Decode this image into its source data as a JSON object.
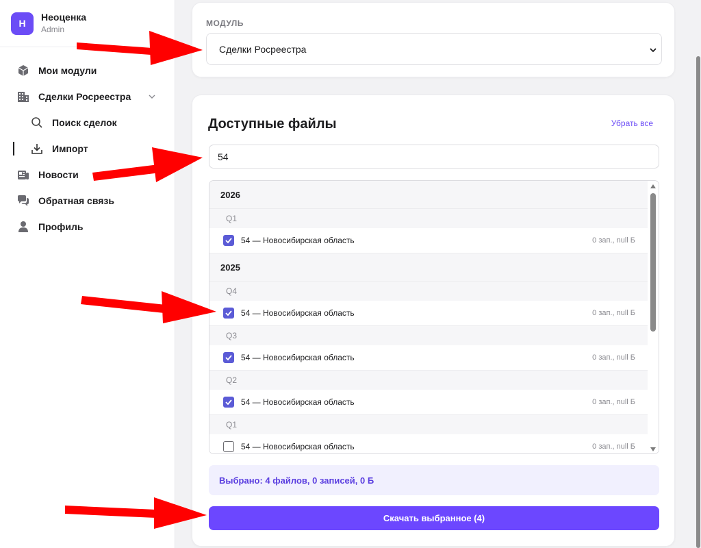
{
  "brand": {
    "initial": "Н",
    "name": "Неоценка",
    "role": "Admin"
  },
  "sidebar": {
    "items": [
      {
        "label": "Мои модули",
        "icon": "cube-icon"
      },
      {
        "label": "Сделки Росреестра",
        "icon": "building-icon"
      },
      {
        "label": "Поиск сделок",
        "icon": "search-icon"
      },
      {
        "label": "Импорт",
        "icon": "download-icon"
      },
      {
        "label": "Новости",
        "icon": "newspaper-icon"
      },
      {
        "label": "Обратная связь",
        "icon": "chat-icon"
      },
      {
        "label": "Профиль",
        "icon": "user-icon"
      }
    ]
  },
  "module": {
    "label": "МОДУЛЬ",
    "selected": "Сделки Росреестра"
  },
  "files": {
    "title": "Доступные файлы",
    "clear_all": "Убрать все",
    "search_value": "54",
    "groups": [
      {
        "year": "2026",
        "quarter": "Q1",
        "file": {
          "name": "54 — Новосибирская область",
          "meta": "0 зап., null Б",
          "checked": true
        }
      },
      {
        "year": "2025",
        "quarter": "Q4",
        "file": {
          "name": "54 — Новосибирская область",
          "meta": "0 зап., null Б",
          "checked": true
        }
      },
      {
        "quarter": "Q3",
        "file": {
          "name": "54 — Новосибирская область",
          "meta": "0 зап., null Б",
          "checked": true
        }
      },
      {
        "quarter": "Q2",
        "file": {
          "name": "54 — Новосибирская область",
          "meta": "0 зап., null Б",
          "checked": true
        }
      },
      {
        "quarter": "Q1",
        "file": {
          "name": "54 — Новосибирская область",
          "meta": "0 зап., null Б",
          "checked": false
        }
      }
    ],
    "summary": "Выбрано: 4 файлов, 0 записей, 0 Б",
    "download_label": "Скачать выбранное (4)"
  },
  "colors": {
    "accent": "#6c47ff",
    "annotation_arrow": "#ff0000"
  }
}
